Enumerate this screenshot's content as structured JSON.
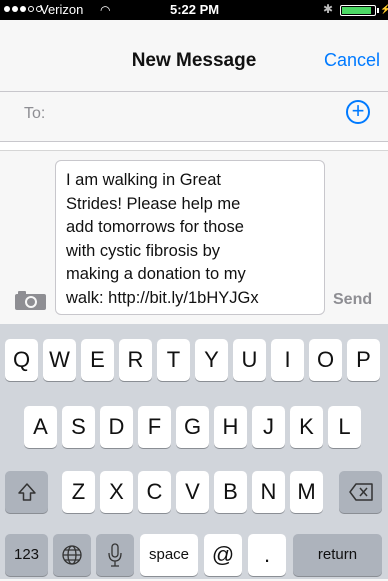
{
  "status_bar": {
    "carrier": "Verizon",
    "time": "5:22 PM",
    "battery_level": 0.9
  },
  "nav": {
    "title": "New Message",
    "cancel_label": "Cancel"
  },
  "recipient": {
    "to_label": "To:"
  },
  "compose": {
    "message_lines": [
      "I am walking in Great",
      "Strides! Please help me",
      "add tomorrows for those",
      "with cystic fibrosis by",
      "making a donation to my",
      "walk: http://bit.ly/1bHYJGx"
    ],
    "send_label": "Send"
  },
  "keyboard": {
    "row1": [
      "Q",
      "W",
      "E",
      "R",
      "T",
      "Y",
      "U",
      "I",
      "O",
      "P"
    ],
    "row2": [
      "A",
      "S",
      "D",
      "F",
      "G",
      "H",
      "J",
      "K",
      "L"
    ],
    "row3": [
      "Z",
      "X",
      "C",
      "V",
      "B",
      "N",
      "M"
    ],
    "numbers_label": "123",
    "space_label": "space",
    "at_label": "@",
    "dot_label": ".",
    "return_label": "return"
  }
}
